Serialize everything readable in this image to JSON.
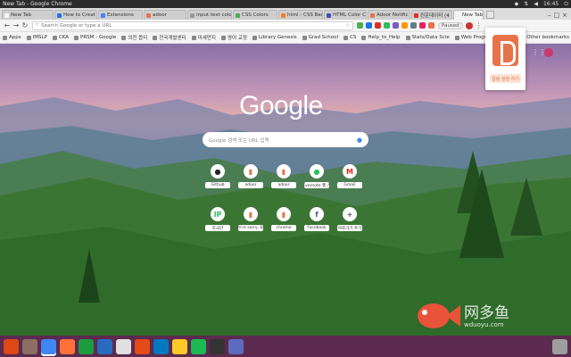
{
  "window": {
    "title": "New Tab - Google Chrome",
    "clock": "16:45",
    "sys_icons": [
      "dropbox-icon",
      "network-icon",
      "volume-icon",
      "power-icon"
    ]
  },
  "tabs": [
    {
      "label": "New Tab",
      "color": "#f4f4f4"
    },
    {
      "label": "How to Creat",
      "color": "#1a73e8"
    },
    {
      "label": "Extensions",
      "color": "#4285f4"
    },
    {
      "label": "adoor",
      "color": "#e8734a"
    },
    {
      "label": "input text colo",
      "color": "#999999"
    },
    {
      "label": "CSS Colors",
      "color": "#4caf50"
    },
    {
      "label": "html - CSS Bac",
      "color": "#f48024"
    },
    {
      "label": "HTML Color C",
      "color": "#3f51b5"
    },
    {
      "label": "Adoor Notific",
      "color": "#e8734a"
    },
    {
      "label": "컨운데이터 (4",
      "color": "#d93025"
    },
    {
      "label": "New Tab",
      "color": "#f4f4f4",
      "active": true
    }
  ],
  "omnibox": {
    "placeholder": "Search Google or type a URL"
  },
  "profile": {
    "paused_label": "Paused"
  },
  "bookmarks": [
    "Apps",
    "IMSLP",
    "CKA",
    "PRSM - Google",
    "의전 옵티",
    "전국개발센터",
    "미세먼지",
    "영어 교정",
    "Library Genesis",
    "Grad School",
    "CS",
    "Help_to_Help",
    "Stats/Data Scie",
    "Web Programm",
    "Misc"
  ],
  "bookmarks_other": "Other bookmarks",
  "popup": {
    "button_label": "알림 설정 하기",
    "accent": "#e8734a"
  },
  "google_logo": "Google",
  "search": {
    "placeholder": "Google 검색 또는 URL 입력"
  },
  "shortcuts": [
    {
      "label": "Github",
      "icon": "github-icon",
      "glyph": "●",
      "color": "#222222"
    },
    {
      "label": "adoor",
      "icon": "adoor-icon",
      "glyph": "▮",
      "color": "#e8734a"
    },
    {
      "label": "adoor",
      "icon": "adoor-icon",
      "glyph": "▮",
      "color": "#e8734a"
    },
    {
      "label": "Evernote 웹 스",
      "icon": "evernote-icon",
      "glyph": "●",
      "color": "#2dbe60"
    },
    {
      "label": "Gmail",
      "icon": "gmail-icon",
      "glyph": "M",
      "color": "#d93025"
    },
    {
      "label": "조국만",
      "icon": "ip-icon",
      "glyph": "IP",
      "color": "#2dbe60"
    },
    {
      "label": "We're sorry, but",
      "icon": "adoor-icon",
      "glyph": "▮",
      "color": "#e8734a"
    },
    {
      "label": "chrome",
      "icon": "adoor-icon",
      "glyph": "▮",
      "color": "#e8734a"
    },
    {
      "label": "Facebook",
      "icon": "facebook-icon",
      "glyph": "f",
      "color": "#3b5998"
    },
    {
      "label": "바로가기 추가",
      "icon": "plus-icon",
      "glyph": "+",
      "color": "#555555"
    }
  ],
  "watermark": {
    "text": "网多鱼",
    "sub": "wduoyu.com"
  },
  "taskbar": [
    {
      "icon": "ubuntu-icon",
      "color": "#dd4814"
    },
    {
      "icon": "files-icon",
      "color": "#8d6e63"
    },
    {
      "icon": "chrome-icon",
      "color": "#4285f4",
      "active": true
    },
    {
      "icon": "firefox-icon",
      "color": "#ff7139"
    },
    {
      "icon": "libreoffice-calc-icon",
      "color": "#1d9b3f"
    },
    {
      "icon": "libreoffice-writer-icon",
      "color": "#2a6bbf"
    },
    {
      "icon": "document-viewer-icon",
      "color": "#e0e0e0"
    },
    {
      "icon": "settings-icon",
      "color": "#e64a19"
    },
    {
      "icon": "trello-icon",
      "color": "#0079bf"
    },
    {
      "icon": "notes-icon",
      "color": "#ffca28"
    },
    {
      "icon": "spotify-icon",
      "color": "#1db954"
    },
    {
      "icon": "terminal-icon",
      "color": "#333333"
    },
    {
      "icon": "code-icon",
      "color": "#5c6bc0"
    },
    {
      "icon": "trash-icon",
      "color": "#9e9e9e"
    }
  ]
}
